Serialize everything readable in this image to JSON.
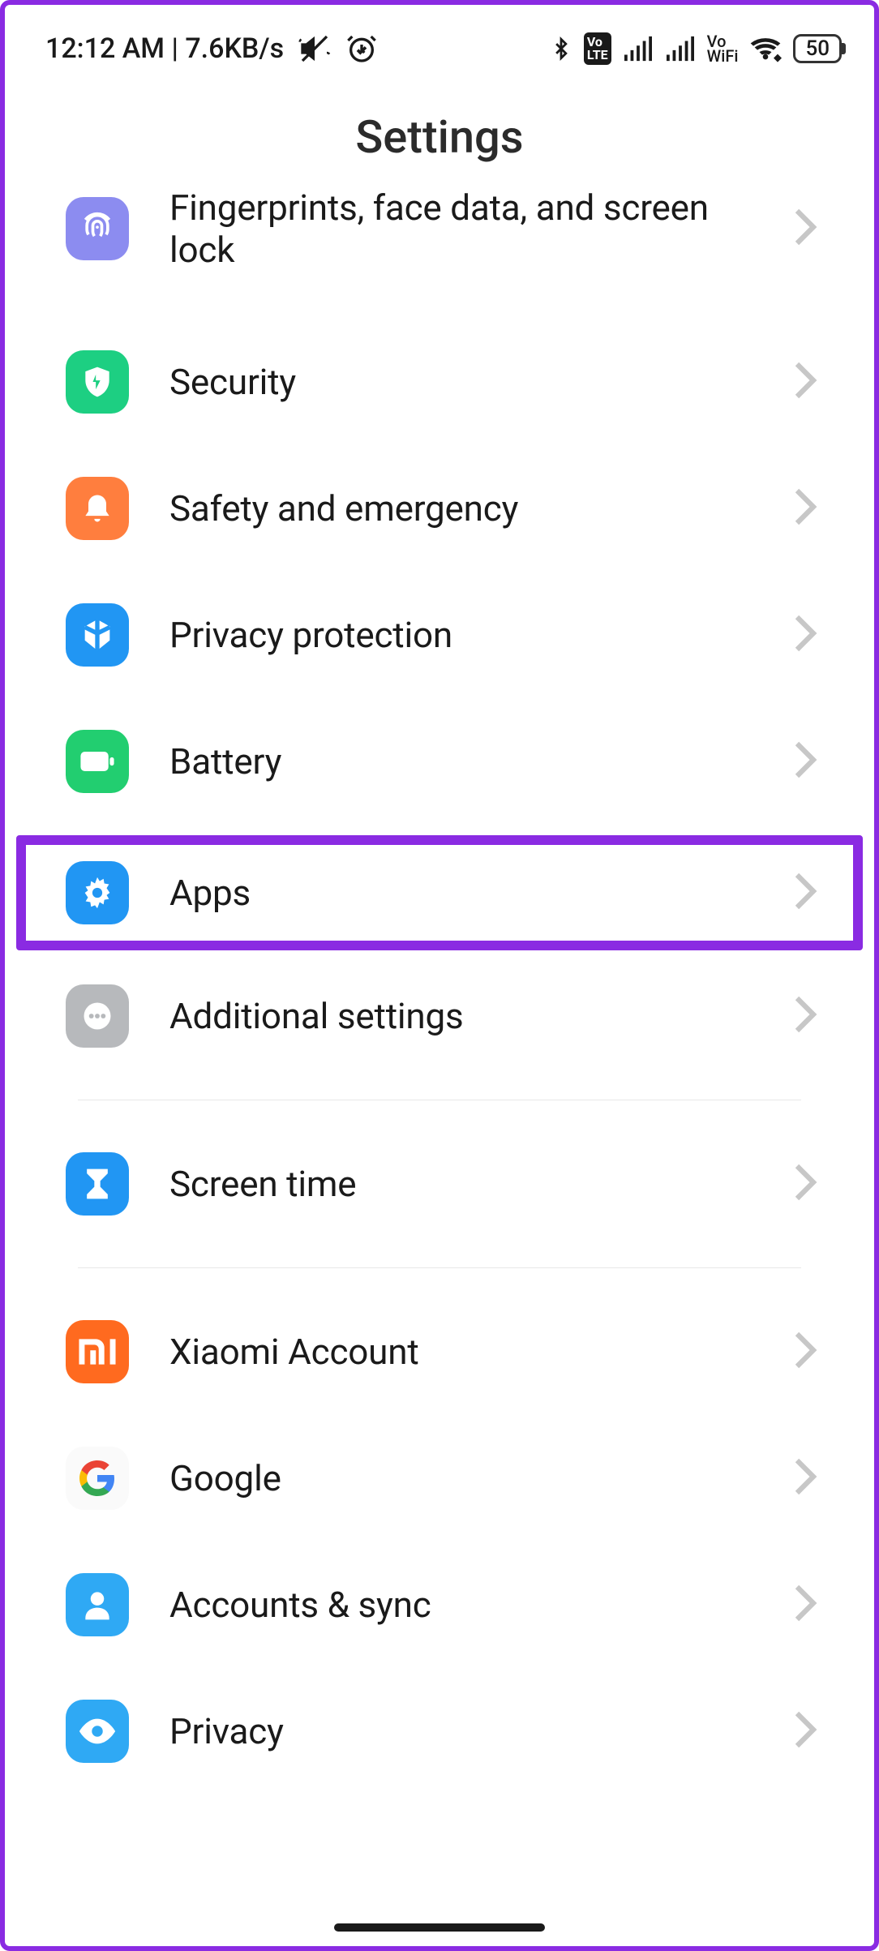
{
  "status": {
    "time": "12:12 AM",
    "net_speed": "7.6KB/s",
    "battery_pct": "50"
  },
  "header": {
    "title": "Settings"
  },
  "items": [
    {
      "label": "Fingerprints, face data, and screen lock"
    },
    {
      "label": "Security"
    },
    {
      "label": "Safety and emergency"
    },
    {
      "label": "Privacy protection"
    },
    {
      "label": "Battery"
    },
    {
      "label": "Apps"
    },
    {
      "label": "Additional settings"
    },
    {
      "label": "Screen time"
    },
    {
      "label": "Xiaomi Account"
    },
    {
      "label": "Google"
    },
    {
      "label": "Accounts & sync"
    },
    {
      "label": "Privacy"
    }
  ]
}
